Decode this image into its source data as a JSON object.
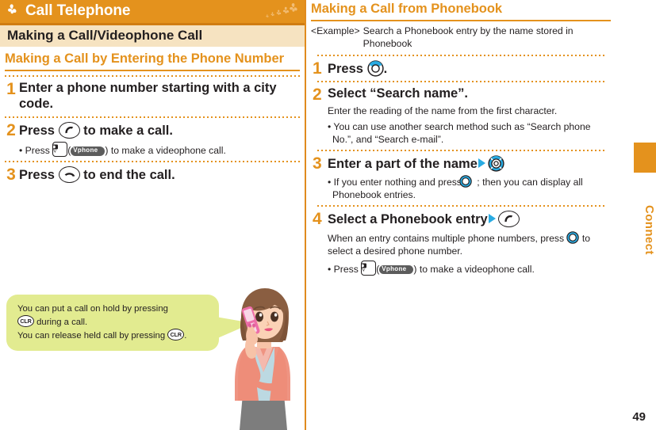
{
  "chapter": {
    "title": "Call Telephone",
    "icon": "clover-icon",
    "deco_icon": "clover-trail-icon",
    "bar_color": "#e4921d"
  },
  "section": {
    "title": "Making a Call/Videophone Call",
    "bar_color": "#f6e3c1"
  },
  "left": {
    "subheading": "Making a Call by Entering the Phone Number",
    "steps": [
      {
        "num": "1",
        "title": "Enter a phone number starting with a city code.",
        "notes": []
      },
      {
        "num": "2",
        "title_before": "Press",
        "title_after": "to make a call.",
        "key": "call-key-icon",
        "bullet_before": "• Press",
        "bullet_mid": "(",
        "bullet_button": "Vphone",
        "bullet_after": ") to make a videophone call."
      },
      {
        "num": "3",
        "title_before": "Press",
        "title_after": "to end the call.",
        "key": "end-call-key-icon"
      }
    ],
    "callout": {
      "line1_a": "You can put a call on hold by pressing",
      "line2_key": "CLR",
      "line2_a": "during a call.",
      "line3_a": "You can release held call by pressing",
      "line3_key": "CLR",
      "line3_b": ".",
      "bg_color": "#e2eb90"
    },
    "illustration": "woman-on-phone-illustration"
  },
  "right": {
    "heading": "Making a Call from Phonebook",
    "example": {
      "label": "<Example>",
      "text": "Search a Phonebook entry by the name stored in Phonebook"
    },
    "steps": [
      {
        "num": "1",
        "title_before": "Press",
        "title_after": ".",
        "key": "nav-up-key-icon"
      },
      {
        "num": "2",
        "title": "Select “Search name”.",
        "note": "Enter the reading of the name from the first character.",
        "bullet": "• You can use another search method such as “Search phone No.”, and “Search e-mail”."
      },
      {
        "num": "3",
        "title": "Enter a part of the name",
        "key": "nav-all-key-icon",
        "bullet_a": "• If you enter nothing and press",
        "bullet_b": "; then you can display all Phonebook entries."
      },
      {
        "num": "4",
        "title": "Select a Phonebook entry",
        "key": "call-key-icon",
        "note_a": "When an entry contains multiple phone numbers, press",
        "note_b": "to select a desired phone number.",
        "bullet_before": "• Press",
        "bullet_mid": "(",
        "bullet_button": "Vphone",
        "bullet_after": ") to make a videophone call."
      }
    ]
  },
  "side_tab": {
    "label": "Connect",
    "color": "#e4921d"
  },
  "page_number": "49"
}
